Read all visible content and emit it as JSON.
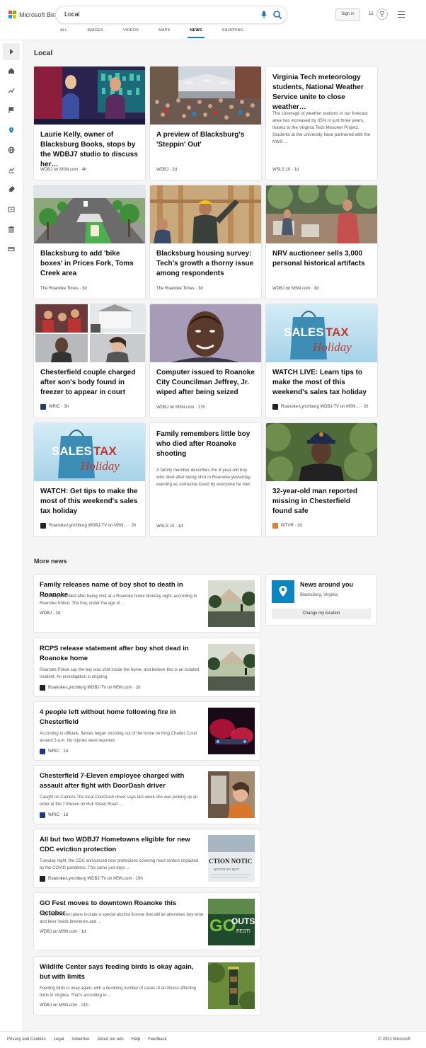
{
  "header": {
    "logo_text": "Microsoft Bing",
    "search_query": "Local",
    "signin_label": "Sign in",
    "rewards_count": "15",
    "tabs": [
      "ALL",
      "IMAGES",
      "VIDEOS",
      "MAPS",
      "NEWS",
      "SHOPPING"
    ],
    "active_tab": "NEWS"
  },
  "local": {
    "title": "Local",
    "cards": [
      {
        "title": "Laurie Kelly, owner of Blacksburg Books, stops by the WDBJ7 studio to discuss her…",
        "source": "WDBJ on MSN.com",
        "age": "4h"
      },
      {
        "title": "A preview of Blacksburg's 'Steppin' Out'",
        "source": "WDBJ",
        "age": "2d"
      },
      {
        "title": "Virginia Tech meteorology students, National Weather Service unite to close weather…",
        "desc": "The coverage of weather stations in our forecast area has increased by 35% in just three years, thanks to the Virginia Tech Mesonet Project. Students at the university have partnered with the NWS ...",
        "source": "WSLS 10",
        "age": "1d"
      },
      {
        "title": "Blacksburg to add 'bike boxes' in Prices Fork, Toms Creek area",
        "source": "The Roanoke Times",
        "age": "3d"
      },
      {
        "title": "Blacksburg housing survey: Tech's growth a thorny issue among respondents",
        "source": "The Roanoke Times",
        "age": "3d"
      },
      {
        "title": "NRV auctioneer sells 3,000 personal historical artifacts",
        "source": "WDBJ on MSN.com",
        "age": "3d"
      },
      {
        "title": "Chesterfield couple charged after son's body found in freezer to appear in court",
        "source": "WRIC",
        "age": "3h"
      },
      {
        "title": "Computer issued to Roanoke City Councilman Jeffrey, Jr. wiped after being seized",
        "source": "WDBJ on MSN.com",
        "age": "17h"
      },
      {
        "title": "WATCH LIVE: Learn tips to make the most of this weekend's sales tax holiday",
        "source": "Roanoke-Lynchburg WDBJ-TV on MSN…",
        "age": "2h"
      },
      {
        "title": "WATCH: Get tips to make the most of this weekend's sales tax holiday",
        "source": "Roanoke-Lynchburg WDBJ-TV on MSN…",
        "age": "2h"
      },
      {
        "title": "Family remembers little boy who died after Roanoke shooting",
        "desc": "A family member describes the 8-year-old boy who died after being shot in Roanoke yesterday evening as someone loved by everyone he met.",
        "source": "WSLS 10",
        "age": "1d"
      },
      {
        "title": "32-year-old man reported missing in Chesterfield found safe",
        "source": "WTVR",
        "age": "2d"
      }
    ],
    "sales_tax_word1": "SALES",
    "sales_tax_word2": "TAX",
    "sales_tax_word3": "Holiday"
  },
  "more": {
    "title": "More news",
    "items": [
      {
        "title": "Family releases name of boy shot to death in Roanoke",
        "desc": "A little boy has died after being shot at a Roanoke home Monday night, according to Roanoke Police. The boy, under the age of ...",
        "source": "WDBJ",
        "age": "2d"
      },
      {
        "title": "RCPS release statement after boy shot dead in Roanoke home",
        "desc": "Roanoke Police say the boy was shot inside the home, and believe this is an isolated incident. An investigation is ongoing.",
        "source": "Roanoke-Lynchburg WDBJ-TV on MSN.com",
        "age": "2d"
      },
      {
        "title": "4 people left without home following fire in Chesterfield",
        "desc": "According to officials, flames began shooting out of the home on King Charles Court around 3 a.m. No injuries were reported.",
        "source": "WRIC",
        "age": "1d"
      },
      {
        "title": "Chesterfield 7-Eleven employee charged with assault after fight with DoorDash driver",
        "desc": "Caught on Camera The local DoorDash driver says last week she was picking up an order at the 7-Eleven on Hull Street Road ...",
        "source": "WRIC",
        "age": "1d"
      },
      {
        "title": "All but two WDBJ7 Hometowns eligible for new CDC eviction protection",
        "desc": "Tuesday night, the CDC announced new protections covering most renters impacted by the COVID pandemic. This came just days ...",
        "source": "Roanoke-Lynchburg WDBJ-TV on MSN.com",
        "age": "19h"
      },
      {
        "title": "GO Fest moves to downtown Roanoke this October",
        "desc": "This year's event plans include a special alcohol license that will let attendees buy wine and beer inside breweries and ...",
        "source": "WDBJ on MSN.com",
        "age": "1d"
      },
      {
        "title": "Wildlife Center says feeding birds is okay again, but with limits",
        "desc": "Feeding birds is okay again, with a declining number of cases of an illness affecting birds in Virginia. That's according to ...",
        "source": "WDBJ on MSN.com",
        "age": "21h"
      }
    ],
    "thumb_texts": {
      "eviction": "CTION NOTIC",
      "eviction_sub": "NOTICE TO QUIT",
      "gofest": "GO",
      "gofest2": "OUTS",
      "gofest3": "FESTI"
    }
  },
  "news_around": {
    "title": "News around you",
    "location": "Blacksburg, Virginia",
    "button": "Change my location"
  },
  "footer": {
    "links": [
      "Privacy and Cookies",
      "Legal",
      "Advertise",
      "About our ads",
      "Help",
      "Feedback"
    ],
    "copyright": "© 2021 Microsoft"
  },
  "colors": {
    "accent": "#0c7ac2",
    "pin": "#0c86c1"
  }
}
